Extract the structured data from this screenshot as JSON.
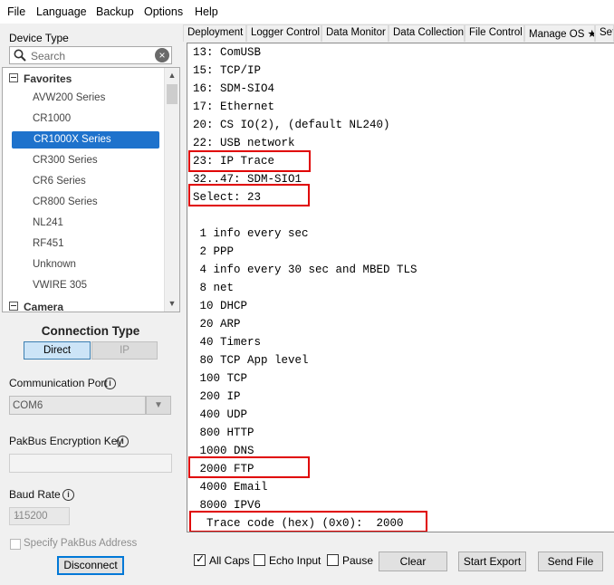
{
  "menu": [
    "File",
    "Language",
    "Backup",
    "Options",
    "Help"
  ],
  "sidebar": {
    "device_type_label": "Device Type",
    "search_placeholder": "Search",
    "groups": [
      {
        "label": "Favorites",
        "items": [
          "AVW200 Series",
          "CR1000",
          "CR1000X Series",
          "CR300 Series",
          "CR6 Series",
          "CR800 Series",
          "NL241",
          "RF451",
          "Unknown",
          "VWIRE 305"
        ]
      },
      {
        "label": "Camera",
        "items": []
      }
    ],
    "selected_item": "CR1000X Series"
  },
  "connection": {
    "title": "Connection Type",
    "direct_label": "Direct",
    "ip_label": "IP",
    "port_label": "Communication Port",
    "port_value": "COM6",
    "key_label": "PakBus Encryption Key",
    "key_value": "",
    "baud_label": "Baud Rate",
    "baud_value": "115200",
    "specify_label": "Specify PakBus Address",
    "disconnect_label": "Disconnect"
  },
  "tabs": [
    "Deployment",
    "Logger Control",
    "Data Monitor",
    "Data Collection",
    "File Control",
    "Manage OS ★",
    "Set"
  ],
  "terminal": {
    "lines": [
      "13: ComUSB",
      "15: TCP/IP",
      "16: SDM-SIO4",
      "17: Ethernet",
      "20: CS IO(2), (default NL240)",
      "22: USB network",
      "23: IP Trace",
      "32..47: SDM-SIO1",
      "Select: 23",
      "",
      " 1 info every sec",
      " 2 PPP",
      " 4 info every 30 sec and MBED TLS",
      " 8 net",
      " 10 DHCP",
      " 20 ARP",
      " 40 Timers",
      " 80 TCP App level",
      " 100 TCP",
      " 200 IP",
      " 400 UDP",
      " 800 HTTP",
      " 1000 DNS",
      " 2000 FTP",
      " 4000 Email",
      " 8000 IPV6",
      "  Trace code (hex) (0x0):  2000"
    ]
  },
  "toolbar": {
    "all_caps_label": "All Caps",
    "all_caps_checked": true,
    "echo_input_label": "Echo Input",
    "pause_label": "Pause",
    "clear_label": "Clear",
    "start_export_label": "Start Export",
    "send_file_label": "Send File"
  },
  "colors": {
    "selection": "#1e72cc",
    "highlight_box": "#e00000",
    "direct_toggle": "#cce4f7"
  }
}
